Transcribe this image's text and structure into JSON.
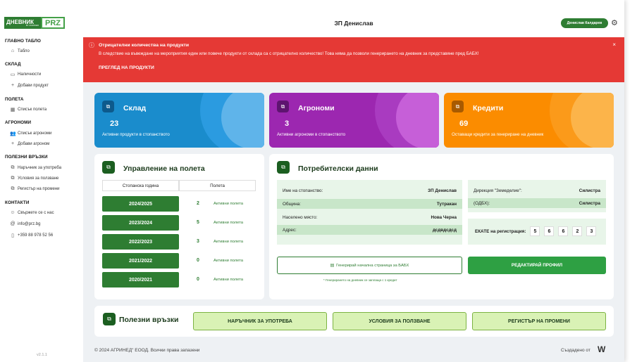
{
  "sidebar": {
    "logo": {
      "main": "ДНЕВНИК",
      "sub": "BY AGRINED",
      "brand": "PRZ"
    },
    "sections": [
      {
        "title": "ГЛАВНО ТАБЛО",
        "items": [
          {
            "label": "Табло",
            "icon": "home-icon"
          }
        ]
      },
      {
        "title": "СКЛАД",
        "items": [
          {
            "label": "Наличности",
            "icon": "inventory-icon"
          },
          {
            "label": "Добави продукт",
            "icon": "plus-icon"
          }
        ]
      },
      {
        "title": "ПОЛЕТА",
        "items": [
          {
            "label": "Списък полета",
            "icon": "map-icon"
          }
        ]
      },
      {
        "title": "АГРОНОМИ",
        "items": [
          {
            "label": "Списък агрономи",
            "icon": "people-icon"
          },
          {
            "label": "Добави агроном",
            "icon": "plus-icon"
          }
        ]
      },
      {
        "title": "ПОЛЕЗНИ ВРЪЗКИ",
        "items": [
          {
            "label": "Наръчник за употреба",
            "icon": "copy-icon"
          },
          {
            "label": "Условия за ползване",
            "icon": "copy-icon"
          },
          {
            "label": "Регистър на промени",
            "icon": "copy-icon"
          }
        ]
      },
      {
        "title": "КОНТАКТИ",
        "items": [
          {
            "label": "Свържете се с нас",
            "icon": "contact-icon"
          },
          {
            "label": "info@prz.bg",
            "icon": "at-icon"
          },
          {
            "label": "+359 88 978 52 56",
            "icon": "phone-icon"
          }
        ]
      }
    ],
    "version": "v2.1.1"
  },
  "header": {
    "title": "ЗП Денислав",
    "user": "Денислав Калдарев"
  },
  "alert": {
    "title": "Отрицателни количества на продукти",
    "message": "В следствие на въвеждане на мероприятия един или повече продукти от склада са с отрицателно количество! Това няма да позволи генерирането на дневник за представяне пред БАБХ!",
    "link": "ПРЕГЛЕД НА ПРОДУКТИ",
    "close": "×"
  },
  "cards": [
    {
      "title": "Склад",
      "value": "23",
      "subtitle": "Активни продукти в стопанството",
      "color": "#1a8ccc"
    },
    {
      "title": "Агрономи",
      "value": "3",
      "subtitle": "Активни агрономи в стопанството",
      "color": "#9c27b0"
    },
    {
      "title": "Кредити",
      "value": "69",
      "subtitle": "Оставащи кредити за генериране на дневник",
      "color": "#fb8c00"
    }
  ],
  "fields": {
    "title": "Управление на полета",
    "col_year": "Стопанска година",
    "col_fields": "Полета",
    "rows": [
      {
        "year": "2024/2025",
        "count": "2",
        "link": "Активни полета"
      },
      {
        "year": "2023/2024",
        "count": "5",
        "link": "Активни полета"
      },
      {
        "year": "2022/2023",
        "count": "3",
        "link": "Активни полета"
      },
      {
        "year": "2021/2022",
        "count": "0",
        "link": "Активни полета"
      },
      {
        "year": "2020/2021",
        "count": "0",
        "link": "Активни полета"
      }
    ]
  },
  "user_data": {
    "title": "Потребителски данни",
    "left": [
      {
        "label": "Име на стопанство:",
        "value": "ЗП Денислав"
      },
      {
        "label": "Община:",
        "value": "Тутракан"
      },
      {
        "label": "Населено място:",
        "value": "Нова Черна"
      },
      {
        "label": "Адрес:",
        "value": "дсдвдсдсд"
      }
    ],
    "right": [
      {
        "label": "Дирекция \"Земеделие\":",
        "value": "Силистра"
      },
      {
        "label": "(ОДБХ):",
        "value": "Силистра"
      }
    ],
    "ekatte_label": "ЕКАТЕ на регистрация:",
    "ekatte": [
      "5",
      "6",
      "6",
      "2",
      "3"
    ],
    "gen_button": "Генерирай начална страница за БАБХ",
    "edit_button": "РЕДАКТИРАЙ ПРОФИЛ",
    "note": "* Генерирането на дневник се заплаща с 1 кредит"
  },
  "links": {
    "title": "Полезни връзки",
    "buttons": [
      "НАРЪЧНИК ЗА УПОТРЕБА",
      "УСЛОВИЯ ЗА ПОЛЗВАНЕ",
      "РЕГИСТЪР НА ПРОМЕНИ"
    ]
  },
  "footer": {
    "copyright": "© 2024 АГРИНЕД\" ЕООД. Всички права запазени",
    "created": "Създадено от"
  }
}
